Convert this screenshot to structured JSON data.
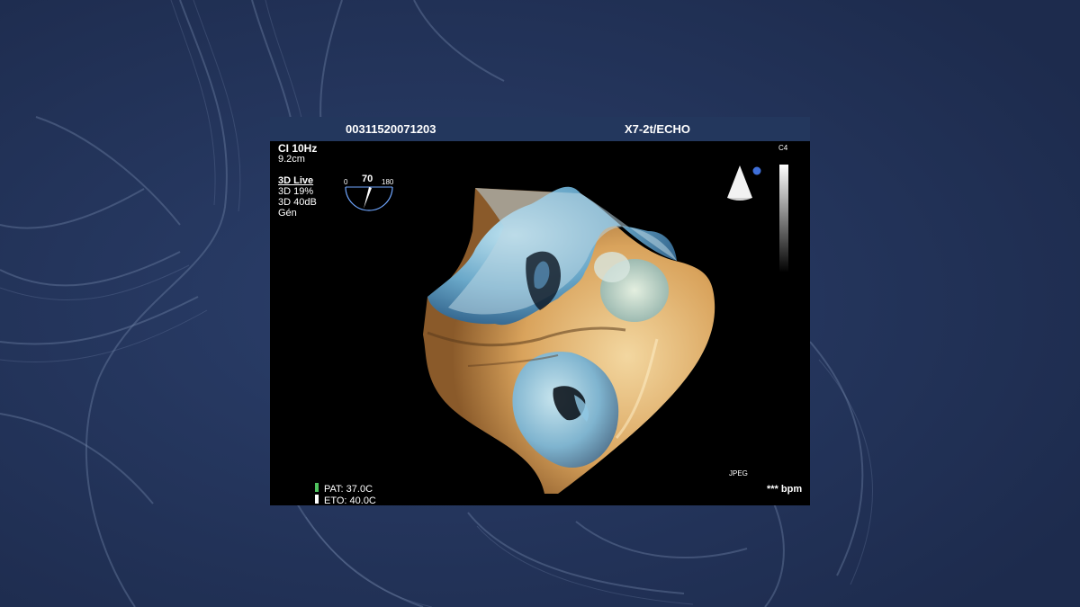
{
  "header": {
    "patient_id": "00311520071203",
    "probe_preset": "X7-2t/ECHO"
  },
  "left_params": {
    "frame_rate": "CI 10Hz",
    "depth": "9.2cm",
    "mode": "3D Live",
    "gain": "3D 19%",
    "compression": "3D 40dB",
    "profile": "Gén"
  },
  "angle_indicator": {
    "value": "70",
    "min": "0",
    "max": "180"
  },
  "right_params": {
    "colormap": "C4",
    "format": "JPEG",
    "heart_rate": "*** bpm"
  },
  "temps": {
    "patient": "PAT: 37.0C",
    "probe": "ETO: 40.0C"
  },
  "colors": {
    "background": "#23345c",
    "header": "#23375d",
    "tissue_tan": "#d9a35c",
    "tissue_blue": "#6aa8c9"
  }
}
